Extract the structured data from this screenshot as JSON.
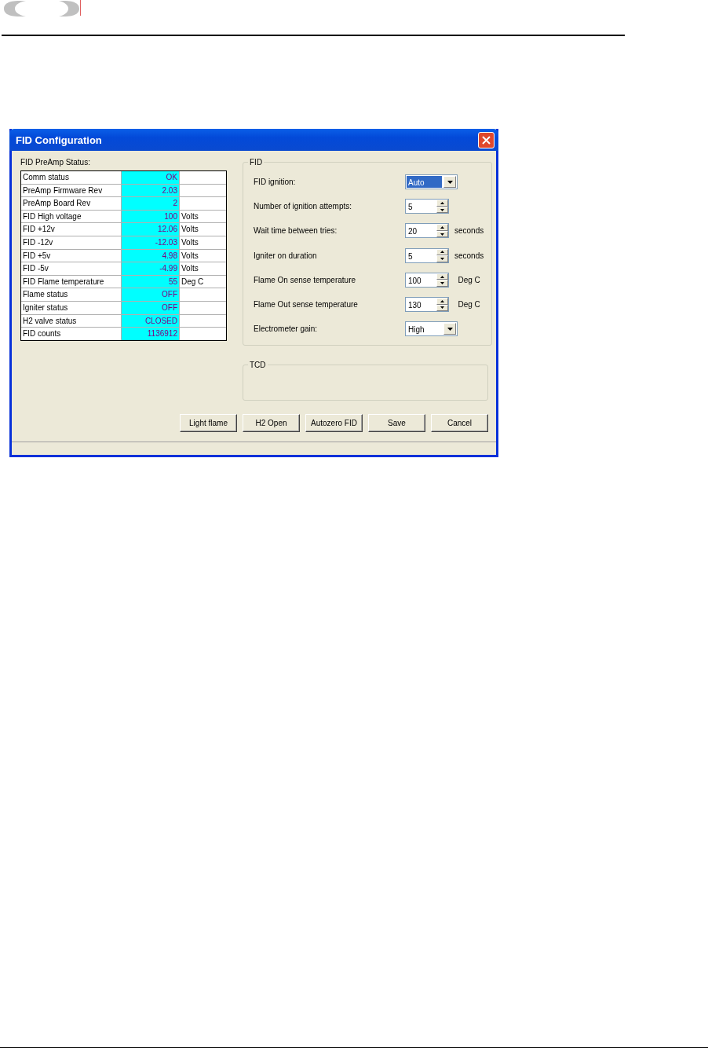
{
  "window": {
    "title": "FID Configuration"
  },
  "status_panel": {
    "label": "FID PreAmp Status:",
    "rows": [
      {
        "name": "Comm status",
        "value": "OK"
      },
      {
        "name": "PreAmp Firmware Rev",
        "value": "2.03"
      },
      {
        "name": "PreAmp Board Rev",
        "value": "2"
      },
      {
        "name": "FID High voltage",
        "value": "100",
        "unit": "Volts"
      },
      {
        "name": "FID +12v",
        "value": "12.06",
        "unit": "Volts"
      },
      {
        "name": "FID -12v",
        "value": "-12.03",
        "unit": "Volts"
      },
      {
        "name": "FID +5v",
        "value": "4.98",
        "unit": "Volts"
      },
      {
        "name": "FID -5v",
        "value": "-4.99",
        "unit": "Volts"
      },
      {
        "name": "FID Flame temperature",
        "value": "55",
        "unit": "Deg C"
      },
      {
        "name": "Flame status",
        "value": "OFF"
      },
      {
        "name": "Igniter status",
        "value": "OFF"
      },
      {
        "name": "H2 valve status",
        "value": "CLOSED"
      },
      {
        "name": "FID counts",
        "value": "1136912"
      }
    ]
  },
  "fid_group": {
    "title": "FID",
    "settings": [
      {
        "kind": "dropdown",
        "label": "FID ignition:",
        "value": "Auto",
        "focused": true
      },
      {
        "kind": "spinner",
        "label": "Number of ignition attempts:",
        "value": "5"
      },
      {
        "kind": "spinner",
        "label": "Wait time between tries:",
        "value": "20",
        "unit": "seconds"
      },
      {
        "kind": "spinner",
        "label": "Igniter on duration",
        "value": "5",
        "unit": "seconds"
      },
      {
        "kind": "spinner",
        "label": "Flame On sense temperature",
        "value": "100",
        "unit": "Deg C"
      },
      {
        "kind": "spinner",
        "label": "Flame Out sense temperature",
        "value": "130",
        "unit": "Deg C"
      },
      {
        "kind": "dropdown",
        "label": "Electrometer gain:",
        "value": "High",
        "focused": false
      }
    ]
  },
  "tcd_group": {
    "title": "TCD"
  },
  "buttons": [
    "Light flame",
    "H2 Open",
    "Autozero FID",
    "Save",
    "Cancel"
  ]
}
